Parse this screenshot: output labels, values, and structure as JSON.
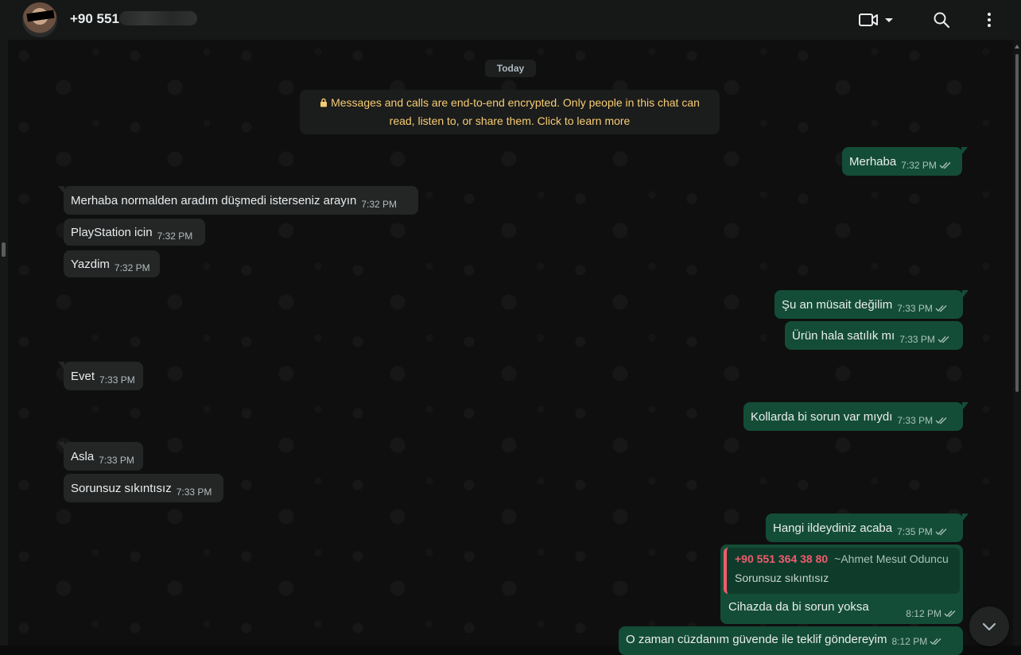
{
  "header": {
    "contact_name": "+90 551",
    "icons": [
      "video-call-icon",
      "chevron-down-icon",
      "search-icon",
      "menu-icon"
    ]
  },
  "chat": {
    "date_separator": "Today",
    "encryption_notice": "Messages and calls are end-to-end encrypted. Only people in this chat can read, listen to, or share them. Click to learn more",
    "messages": [
      {
        "direction": "out",
        "text": "Merhaba",
        "time": "7:32 PM",
        "status": "read"
      },
      {
        "direction": "in",
        "text": "Merhaba normalden aradım düşmedi isterseniz arayın",
        "time": "7:32 PM"
      },
      {
        "direction": "in",
        "text": "PlayStation icin",
        "time": "7:32 PM"
      },
      {
        "direction": "in",
        "text": "Yazdim",
        "time": "7:32 PM"
      },
      {
        "direction": "out",
        "text": "Şu an müsait değilim",
        "time": "7:33 PM",
        "status": "read"
      },
      {
        "direction": "out",
        "text": "Ürün hala satılık mı",
        "time": "7:33 PM",
        "status": "read"
      },
      {
        "direction": "in",
        "text": "Evet",
        "time": "7:33 PM"
      },
      {
        "direction": "out",
        "text": "Kollarda bi sorun var mıydı",
        "time": "7:33 PM",
        "status": "read"
      },
      {
        "direction": "in",
        "text": "Asla",
        "time": "7:33 PM"
      },
      {
        "direction": "in",
        "text": "Sorunsuz sıkıntısız",
        "time": "7:33 PM"
      },
      {
        "direction": "out",
        "text": "Hangi ildeydiniz acaba",
        "time": "7:35 PM",
        "status": "read"
      },
      {
        "direction": "out",
        "text": "Cihazda da bi sorun yoksa",
        "time": "8:12 PM",
        "status": "read",
        "quoted": {
          "sender_number": "+90 551 364 38 80",
          "sender_alias": "~Ahmet Mesut Oduncu",
          "text": "Sorunsuz sıkıntısız"
        }
      },
      {
        "direction": "out",
        "text": "O zaman cüzdanım güvende ile teklif göndereyim",
        "time": "8:12 PM",
        "status": "read"
      }
    ]
  },
  "colors": {
    "incoming_bubble": "#242626",
    "outgoing_bubble": "#144d37",
    "notice_text": "#f7cd73",
    "quote_accent": "#f15c6d"
  }
}
